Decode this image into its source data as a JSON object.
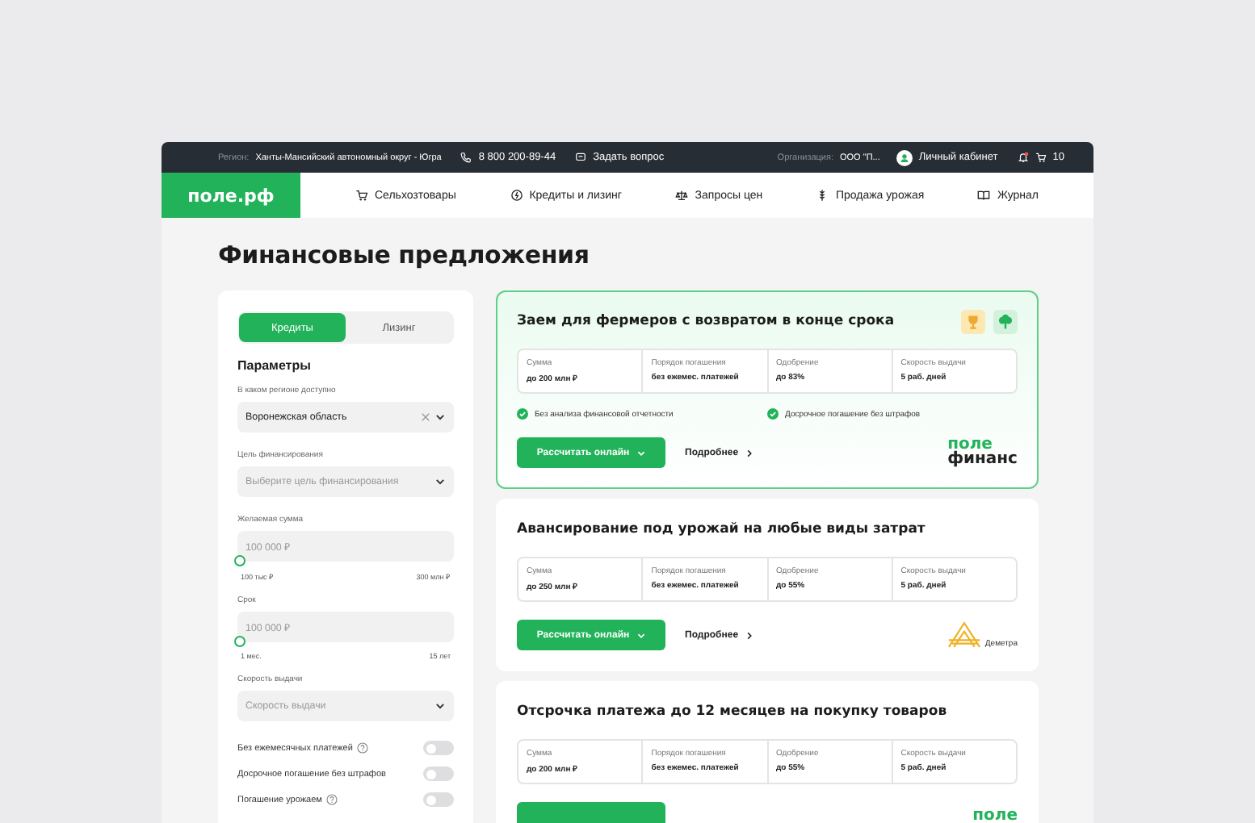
{
  "topbar": {
    "region_label": "Регион:",
    "region": "Ханты-Мансийский автономный округ - Югра",
    "phone": "8 800 200-89-44",
    "ask": "Задать вопрос",
    "org_label": "Организация:",
    "org": "ООО \"П...",
    "account": "Личный кабинет",
    "notifications_unread": true,
    "cart_count": "10"
  },
  "nav": {
    "logo": "поле.рф",
    "items": [
      {
        "kind": "cart",
        "label": "Сельхозтовары"
      },
      {
        "kind": "coin",
        "label": "Кредиты и лизинг"
      },
      {
        "kind": "scales",
        "label": "Запросы цен"
      },
      {
        "kind": "grain",
        "label": "Продажа урожая"
      },
      {
        "kind": "book",
        "label": "Журнал"
      }
    ]
  },
  "page_title": "Финансовые предложения",
  "filters": {
    "tabs": [
      {
        "label": "Кредиты",
        "selected": true
      },
      {
        "label": "Лизинг",
        "selected": false
      }
    ],
    "heading": "Параметры",
    "fields": [
      {
        "kind": "select",
        "label": "В каком регионе доступно",
        "value": "Воронежская область",
        "clearable": true
      },
      {
        "kind": "select",
        "label": "Цель финансирования",
        "placeholder": "Выберите цель финансирования"
      },
      {
        "kind": "range",
        "label": "Желаемая сумма",
        "placeholder": "100 000 ₽",
        "level": 0,
        "min": "100 тыс ₽",
        "max": "300 млн ₽"
      },
      {
        "kind": "range",
        "label": "Срок",
        "placeholder": "100 000 ₽",
        "level": 0,
        "min": "1 мес.",
        "max": "15 лет"
      },
      {
        "kind": "select",
        "label": "Скорость выдачи",
        "placeholder": "Скорость выдачи"
      }
    ],
    "toggles": [
      {
        "label": "Без ежемесячных платежей",
        "help": true,
        "on": false
      },
      {
        "label": "Досрочное погашение без штрафов",
        "help": false,
        "on": false
      },
      {
        "label": "Погашение урожаем",
        "help": true,
        "on": false
      }
    ]
  },
  "offers": [
    {
      "title": "Заем для фермеров с возвратом в конце срока",
      "highlighted": true,
      "badges": [
        {
          "kind": "trophy"
        },
        {
          "kind": "tree"
        }
      ],
      "stats": [
        {
          "label": "Сумма",
          "value": "до 200 млн ₽"
        },
        {
          "label": "Порядок погашения",
          "value": "без ежемес. платежей"
        },
        {
          "label": "Одобрение",
          "value": "до 83%"
        },
        {
          "label": "Скорость выдачи",
          "value": "5 раб. дней"
        }
      ],
      "features": [
        "Без анализа финансовой отчетности",
        "Досрочное погашение без штрафов"
      ],
      "calc_button": "Рассчитать онлайн",
      "more_link": "Подробнее",
      "logo": {
        "kind": "pole",
        "lines": [
          "поле",
          "финанс"
        ]
      }
    },
    {
      "title": "Авансирование под урожай на любые виды затрат",
      "highlighted": false,
      "stats": [
        {
          "label": "Сумма",
          "value": "до 250 млн ₽"
        },
        {
          "label": "Порядок погашения",
          "value": "без ежемес. платежей"
        },
        {
          "label": "Одобрение",
          "value": "до 55%"
        },
        {
          "label": "Скорость выдачи",
          "value": "5 раб. дней"
        }
      ],
      "calc_button": "Рассчитать онлайн",
      "more_link": "Подробнее",
      "logo": {
        "kind": "demetra",
        "lines": [
          "Деметра"
        ]
      }
    },
    {
      "title": "Отсрочка платежа до 12 месяцев на покупку товаров",
      "highlighted": false,
      "stats": [
        {
          "label": "Сумма",
          "value": "до 200 млн ₽"
        },
        {
          "label": "Порядок погашения",
          "value": "без ежемес. платежей"
        },
        {
          "label": "Одобрение",
          "value": "до 55%"
        },
        {
          "label": "Скорость выдачи",
          "value": "5 раб. дней"
        }
      ],
      "logo": {
        "kind": "pole",
        "lines": [
          "поле"
        ]
      }
    }
  ]
}
